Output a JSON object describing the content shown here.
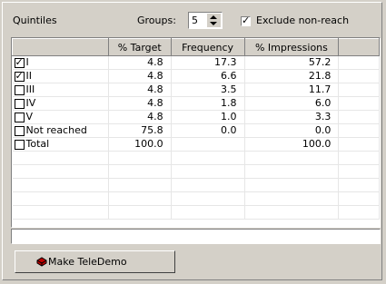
{
  "header": {
    "title": "Quintiles",
    "groups_label": "Groups:",
    "groups_value": "5",
    "exclude_label": "Exclude non-reach",
    "exclude_checked": true
  },
  "table": {
    "columns": [
      "",
      "% Target",
      "Frequency",
      "% Impressions",
      ""
    ],
    "rows": [
      {
        "checked": true,
        "label": "I",
        "target": "4.8",
        "frequency": "17.3",
        "impressions": "57.2"
      },
      {
        "checked": true,
        "label": "II",
        "target": "4.8",
        "frequency": "6.6",
        "impressions": "21.8"
      },
      {
        "checked": false,
        "label": "III",
        "target": "4.8",
        "frequency": "3.5",
        "impressions": "11.7"
      },
      {
        "checked": false,
        "label": "IV",
        "target": "4.8",
        "frequency": "1.8",
        "impressions": "6.0"
      },
      {
        "checked": false,
        "label": "V",
        "target": "4.8",
        "frequency": "1.0",
        "impressions": "3.3"
      },
      {
        "checked": false,
        "label": "Not reached",
        "target": "75.8",
        "frequency": "0.0",
        "impressions": "0.0"
      },
      {
        "checked": false,
        "label": "Total",
        "target": "100.0",
        "frequency": "",
        "impressions": "100.0"
      },
      {
        "checked": null,
        "label": "",
        "target": "",
        "frequency": "",
        "impressions": ""
      },
      {
        "checked": null,
        "label": "",
        "target": "",
        "frequency": "",
        "impressions": ""
      },
      {
        "checked": null,
        "label": "",
        "target": "",
        "frequency": "",
        "impressions": ""
      },
      {
        "checked": null,
        "label": "",
        "target": "",
        "frequency": "",
        "impressions": ""
      },
      {
        "checked": null,
        "label": "",
        "target": "",
        "frequency": "",
        "impressions": ""
      }
    ]
  },
  "button": {
    "label": "Make TeleDemo",
    "icon": "teledemo-icon"
  },
  "colors": {
    "window_bg": "#d4d0c8",
    "grid_line": "#e6e6e6"
  }
}
